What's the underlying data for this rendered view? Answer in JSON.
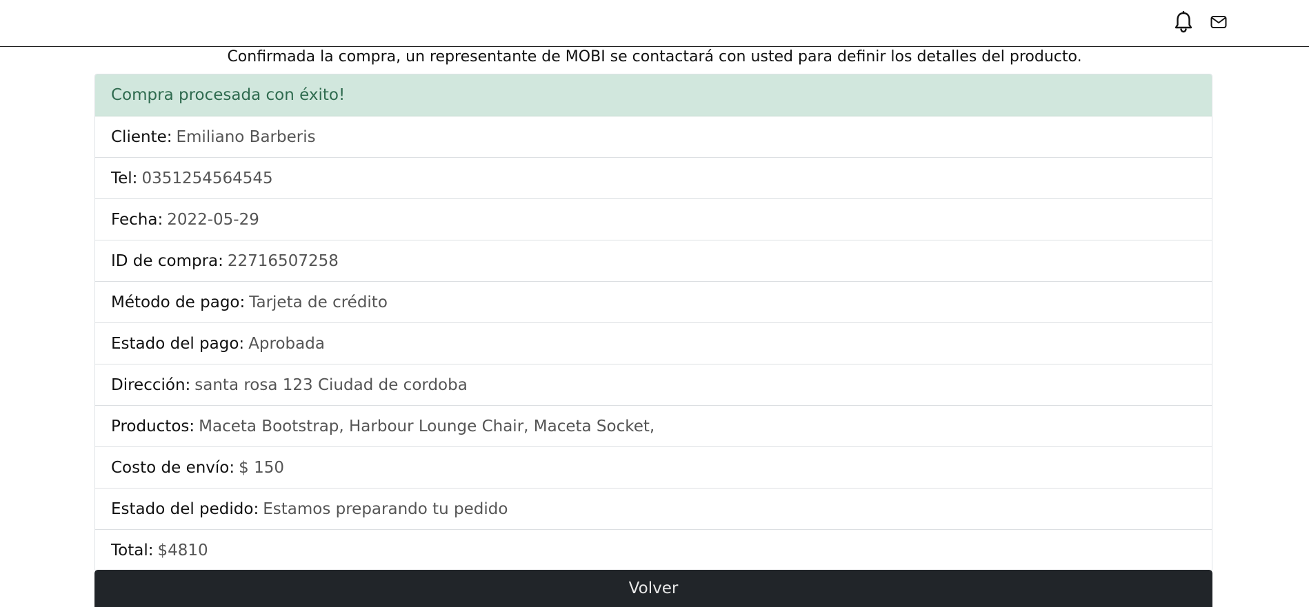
{
  "header": {
    "notification_icon": "bell-icon",
    "mail_icon": "mail-icon"
  },
  "notice": "Confirmada la compra, un representante de MOBI se contactará con usted para definir los detalles del producto.",
  "alert": {
    "text": "Compra procesada con éxito!",
    "color": "#d1e7dd"
  },
  "details": [
    {
      "label": "Cliente:",
      "value": "Emiliano Barberis"
    },
    {
      "label": "Tel:",
      "value": "0351254564545"
    },
    {
      "label": "Fecha:",
      "value": "2022-05-29"
    },
    {
      "label": "ID de compra:",
      "value": "22716507258"
    },
    {
      "label": "Método de pago:",
      "value": "Tarjeta de crédito"
    },
    {
      "label": "Estado del pago:",
      "value": "Aprobada"
    },
    {
      "label": "Dirección:",
      "value": "santa rosa 123 Ciudad de cordoba"
    },
    {
      "label": "Productos:",
      "value": "Maceta Bootstrap, Harbour Lounge Chair, Maceta Socket,"
    },
    {
      "label": "Costo de envío:",
      "value": "$ 150"
    },
    {
      "label": "Estado del pedido:",
      "value": "Estamos preparando tu pedido"
    },
    {
      "label": "Total:",
      "value": "$4810"
    }
  ],
  "volver_label": "Volver"
}
